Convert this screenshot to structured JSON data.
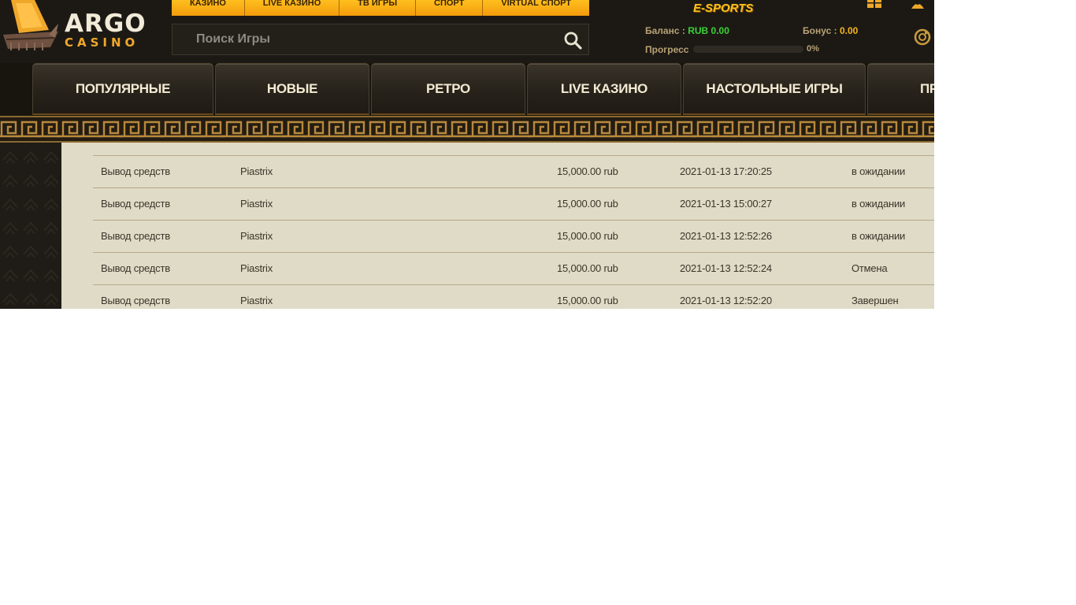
{
  "header": {
    "logo": {
      "word": "ARGO",
      "sub": "CASINO"
    },
    "top_nav": [
      {
        "label": "Казино"
      },
      {
        "label": "Live Казино"
      },
      {
        "label": "ТВ Игры"
      },
      {
        "label": "Спорт"
      },
      {
        "label": "Virtual Спорт"
      }
    ],
    "esports_label": "E-SPORTS",
    "search": {
      "placeholder": "Поиск Игры",
      "value": ""
    },
    "balance": {
      "label": "Баланс :",
      "value": "RUB 0.00"
    },
    "bonus": {
      "label": "Бонус :",
      "value": "0.00"
    },
    "progress": {
      "label": "Прогресс",
      "percent": 0,
      "value_text": "0%"
    }
  },
  "categories": [
    {
      "label": "Популярные"
    },
    {
      "label": "Новые"
    },
    {
      "label": "Ретро"
    },
    {
      "label": "Live казино"
    },
    {
      "label": "Настольные игры"
    },
    {
      "label": "Пр"
    }
  ],
  "table": {
    "rows": [
      {
        "type": "Вывод средств",
        "method": "Piastrix",
        "details": "",
        "amount": "15,000.00 rub",
        "date": "2021-01-13 17:20:25",
        "status": "в ожидании"
      },
      {
        "type": "Вывод средств",
        "method": "Piastrix",
        "details": "",
        "amount": "15,000.00 rub",
        "date": "2021-01-13 15:00:27",
        "status": "в ожидании"
      },
      {
        "type": "Вывод средств",
        "method": "Piastrix",
        "details": "",
        "amount": "15,000.00 rub",
        "date": "2021-01-13 12:52:26",
        "status": "в ожидании"
      },
      {
        "type": "Вывод средств",
        "method": "Piastrix",
        "details": "",
        "amount": "15,000.00 rub",
        "date": "2021-01-13 12:52:24",
        "status": "Отмена"
      },
      {
        "type": "Вывод средств",
        "method": "Piastrix",
        "details": "",
        "amount": "15,000.00 rub",
        "date": "2021-01-13 12:52:20",
        "status": "Завершен"
      }
    ]
  },
  "colors": {
    "accent": "#f0a82a",
    "balance_green": "#3ad235",
    "bonus_yellow": "#f7b51c",
    "table_bg": "#dfdbc6"
  }
}
